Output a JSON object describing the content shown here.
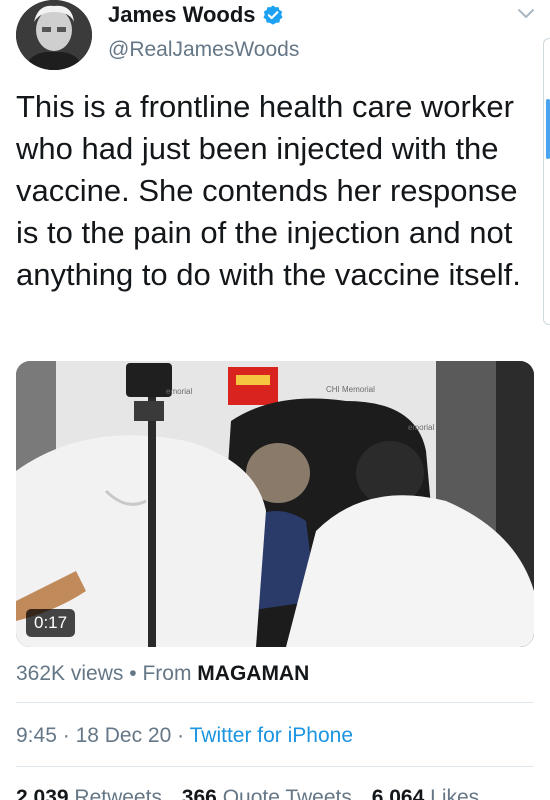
{
  "author": {
    "display_name": "James Woods",
    "handle": "@RealJamesWoods",
    "verified": true,
    "avatar_icon": "avatar-photo",
    "menu_icon": "chevron-down-icon"
  },
  "tweet": {
    "text": "This is a frontline health care worker who had just been injected with the vaccine. She contends her response is to the pain of the injection and not anything to do with the vaccine itself."
  },
  "media": {
    "duration": "0:17",
    "banner_left": "emorial",
    "banner_right": "CHI Memorial",
    "banner_far": "emorial"
  },
  "views": {
    "count": "362K views",
    "separator": "•",
    "from_label": "From",
    "source": "MAGAMAN"
  },
  "meta": {
    "time": "9:45",
    "sep1": "·",
    "date": "18 Dec 20",
    "sep2": "·",
    "client": "Twitter for iPhone"
  },
  "stats": {
    "retweets_count": "2,039",
    "retweets_label": "Retweets",
    "quotes_count": "366",
    "quotes_label": "Quote Tweets",
    "likes_count": "6,064",
    "likes_label": "Likes"
  },
  "colors": {
    "link": "#1b95e0",
    "secondary": "#657786",
    "verified": "#1da1f2"
  }
}
